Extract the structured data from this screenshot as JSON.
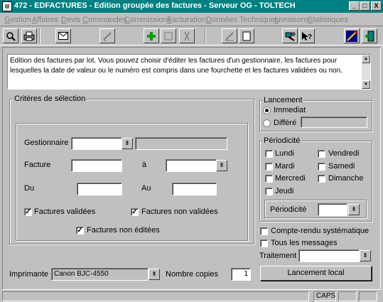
{
  "window": {
    "title": "472 - EDFACTURES - Edition groupée des factures - Serveur OG - TOLTECH",
    "icon_glyph": "▤",
    "minimize_glyph": "_",
    "maximize_glyph": "□",
    "close_glyph": "X"
  },
  "menu": [
    "Gestion",
    "Affaires",
    "Devis",
    "Commandes",
    "Commissions",
    "Facturation",
    "Données Techniques",
    "Livraisons",
    "Statistiques"
  ],
  "toolbar": {
    "icons": [
      "search-icon",
      "print-icon",
      "mail-icon",
      "edit-icon",
      "add-icon",
      "blank-icon",
      "delete-icon",
      "clear-icon",
      "new-page-icon",
      "tools-icon",
      "help-icon",
      "wizard-icon",
      "exit-icon"
    ]
  },
  "description": "Edition des factures par lot.  Vous pouvez choisir d'éditer les factures d'un gestionnaire, les factures pour lesquelles la date de valeur ou le numéro est compris dans une fourchette et  les factures validées ou non.",
  "criteria": {
    "group_label": "Critères de sélection",
    "gestionnaire_label": "Gestionnaire",
    "gestionnaire_value": "",
    "gestionnaire_name": "",
    "facture_label": "Facture",
    "facture_from": "",
    "a_label": "à",
    "facture_to": "",
    "du_label": "Du",
    "du_value": "",
    "au_label": "Au",
    "au_value": "",
    "validees_label": "Factures validées",
    "validees_checked": true,
    "non_validees_label": "Factures non validées",
    "non_validees_checked": true,
    "non_editees_label": "Factures non éditées",
    "non_editees_checked": true
  },
  "lancement": {
    "group_label": "Lancement",
    "immediat_label": "Immediat",
    "differe_label": "Différé",
    "selected": "Immediat",
    "differe_value": ""
  },
  "periodicite": {
    "group_label": "Périodicité",
    "days": [
      {
        "label": "Lundi",
        "checked": false
      },
      {
        "label": "Mardi",
        "checked": false
      },
      {
        "label": "Mercredi",
        "checked": false
      },
      {
        "label": "Jeudi",
        "checked": false
      },
      {
        "label": "Vendredi",
        "checked": false
      },
      {
        "label": "Samedi",
        "checked": false
      },
      {
        "label": "Dimanche",
        "checked": false
      }
    ],
    "periodicite_label": "Périodicité",
    "periodicite_value": ""
  },
  "options": {
    "compte_rendu_label": "Compte-rendu systématique",
    "compte_rendu_checked": false,
    "tous_messages_label": "Tous les messages",
    "tous_messages_checked": false,
    "traitement_label": "Traitement",
    "traitement_value": ""
  },
  "bottom": {
    "imprimante_label": "Imprimante",
    "imprimante_value": "Canon  BJC-4550",
    "copies_label": "Nombre copies",
    "copies_value": "1",
    "launch_button": "Lancement local"
  },
  "status": {
    "caps": "CAPS"
  },
  "glyphs": {
    "dropdown": "⇟",
    "check": "✓",
    "up": "▲",
    "down": "▼"
  }
}
